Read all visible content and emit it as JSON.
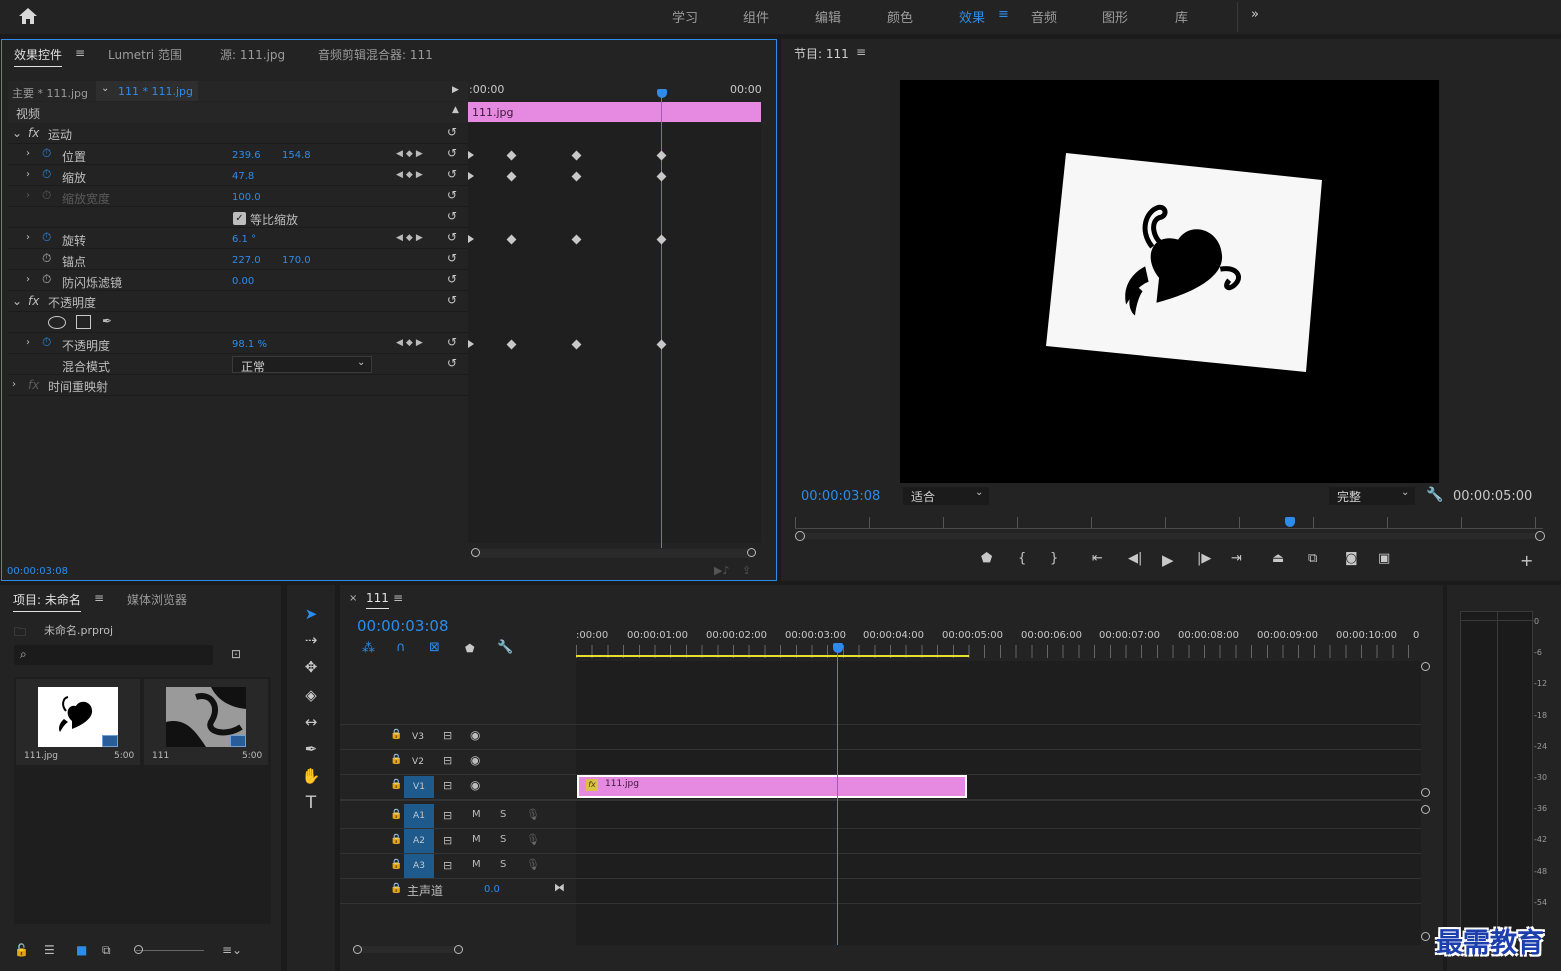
{
  "workspaces": [
    "学习",
    "组件",
    "编辑",
    "颜色",
    "效果",
    "音频",
    "图形",
    "库"
  ],
  "active_workspace": "效果",
  "more": "»",
  "effect_panel": {
    "tabs": [
      "效果控件",
      "Lumetri 范围",
      "源: 111.jpg",
      "音频剪辑混合器: 111"
    ],
    "master_label": "主要 * 111.jpg",
    "clip_label": "111 * 111.jpg",
    "ruler_start": ":00:00",
    "ruler_end": "00:00",
    "clip_bar": "111.jpg",
    "video_header": "视频",
    "motion": "运动",
    "fx": "fx",
    "position_label": "位置",
    "position_x": "239.6",
    "position_y": "154.8",
    "scale_label": "缩放",
    "scale_val": "47.8",
    "scale_width_label": "缩放宽度",
    "scale_width_val": "100.0",
    "uniform_label": "等比缩放",
    "rotation_label": "旋转",
    "rotation_val": "6.1 °",
    "anchor_label": "锚点",
    "anchor_x": "227.0",
    "anchor_y": "170.0",
    "flicker_label": "防闪烁滤镜",
    "flicker_val": "0.00",
    "opacity_header": "不透明度",
    "opacity_label": "不透明度",
    "opacity_val": "98.1 %",
    "blend_label": "混合模式",
    "blend_val": "正常",
    "time_remap": "时间重映射",
    "timecode": "00:00:03:08"
  },
  "program": {
    "title": "节目: 111",
    "timecode": "00:00:03:08",
    "fit": "适合",
    "quality": "完整",
    "duration": "00:00:05:00"
  },
  "project": {
    "tabs": [
      "项目: 未命名",
      "媒体浏览器"
    ],
    "file": "未命名.prproj",
    "items": [
      {
        "name": "111.jpg",
        "duration": "5:00"
      },
      {
        "name": "111",
        "duration": "5:00"
      }
    ]
  },
  "timeline": {
    "tab": "111",
    "timecode": "00:00:03:08",
    "ticks": [
      ":00:00",
      "00:00:01:00",
      "00:00:02:00",
      "00:00:03:00",
      "00:00:04:00",
      "00:00:05:00",
      "00:00:06:00",
      "00:00:07:00",
      "00:00:08:00",
      "00:00:09:00",
      "00:00:10:00",
      "0"
    ],
    "tracks_video": [
      "V3",
      "V2",
      "V1"
    ],
    "tracks_audio": [
      "A1",
      "A2",
      "A3"
    ],
    "master_label": "主声道",
    "master_val": "0.0",
    "clip": "111.jpg",
    "m": "M",
    "s": "S"
  },
  "meter": [
    "0",
    "-6",
    "-12",
    "-18",
    "-24",
    "-30",
    "-36",
    "-42",
    "-48",
    "-54"
  ],
  "watermark": "最需教育",
  "colors": {
    "accent": "#2d8ceb",
    "clip": "#e58ae0",
    "panel": "#232323"
  }
}
